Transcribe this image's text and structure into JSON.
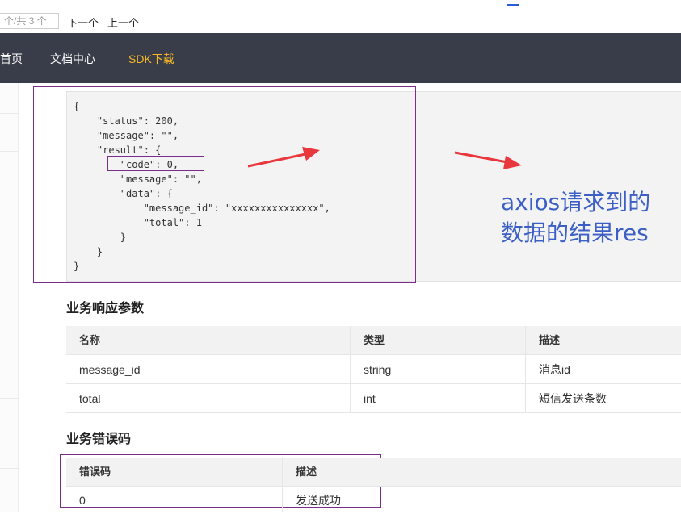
{
  "find_bar": {
    "count_placeholder": "个/共 3 个",
    "next_label": "下一个",
    "prev_label": "上一个"
  },
  "nav": {
    "items": [
      {
        "label": "首页",
        "active": false
      },
      {
        "label": "文档中心",
        "active": false
      },
      {
        "label": "SDK下载",
        "active": true
      }
    ],
    "active_color": "#f7b824"
  },
  "code": {
    "lines": [
      "{",
      "    \"status\": 200,",
      "    \"message\": \"\",",
      "    \"result\": {",
      "        \"code\": 0,",
      "        \"message\": \"\",",
      "        \"data\": {",
      "            \"message_id\": \"xxxxxxxxxxxxxxx\",",
      "            \"total\": 1",
      "        }",
      "    }",
      "}"
    ]
  },
  "annotation": {
    "line1": "axios请求到的",
    "line2": "数据的结果res",
    "color": "#3c5fc5",
    "arrow_color": "#e8383d"
  },
  "response_params": {
    "title": "业务响应参数",
    "headers": [
      "名称",
      "类型",
      "描述"
    ],
    "rows": [
      [
        "message_id",
        "string",
        "消息id"
      ],
      [
        "total",
        "int",
        "短信发送条数"
      ]
    ]
  },
  "error_codes": {
    "title": "业务错误码",
    "headers": [
      "错误码",
      "描述"
    ],
    "rows": [
      [
        "0",
        "发送成功"
      ]
    ]
  },
  "outline_color": "#7b2d8b"
}
